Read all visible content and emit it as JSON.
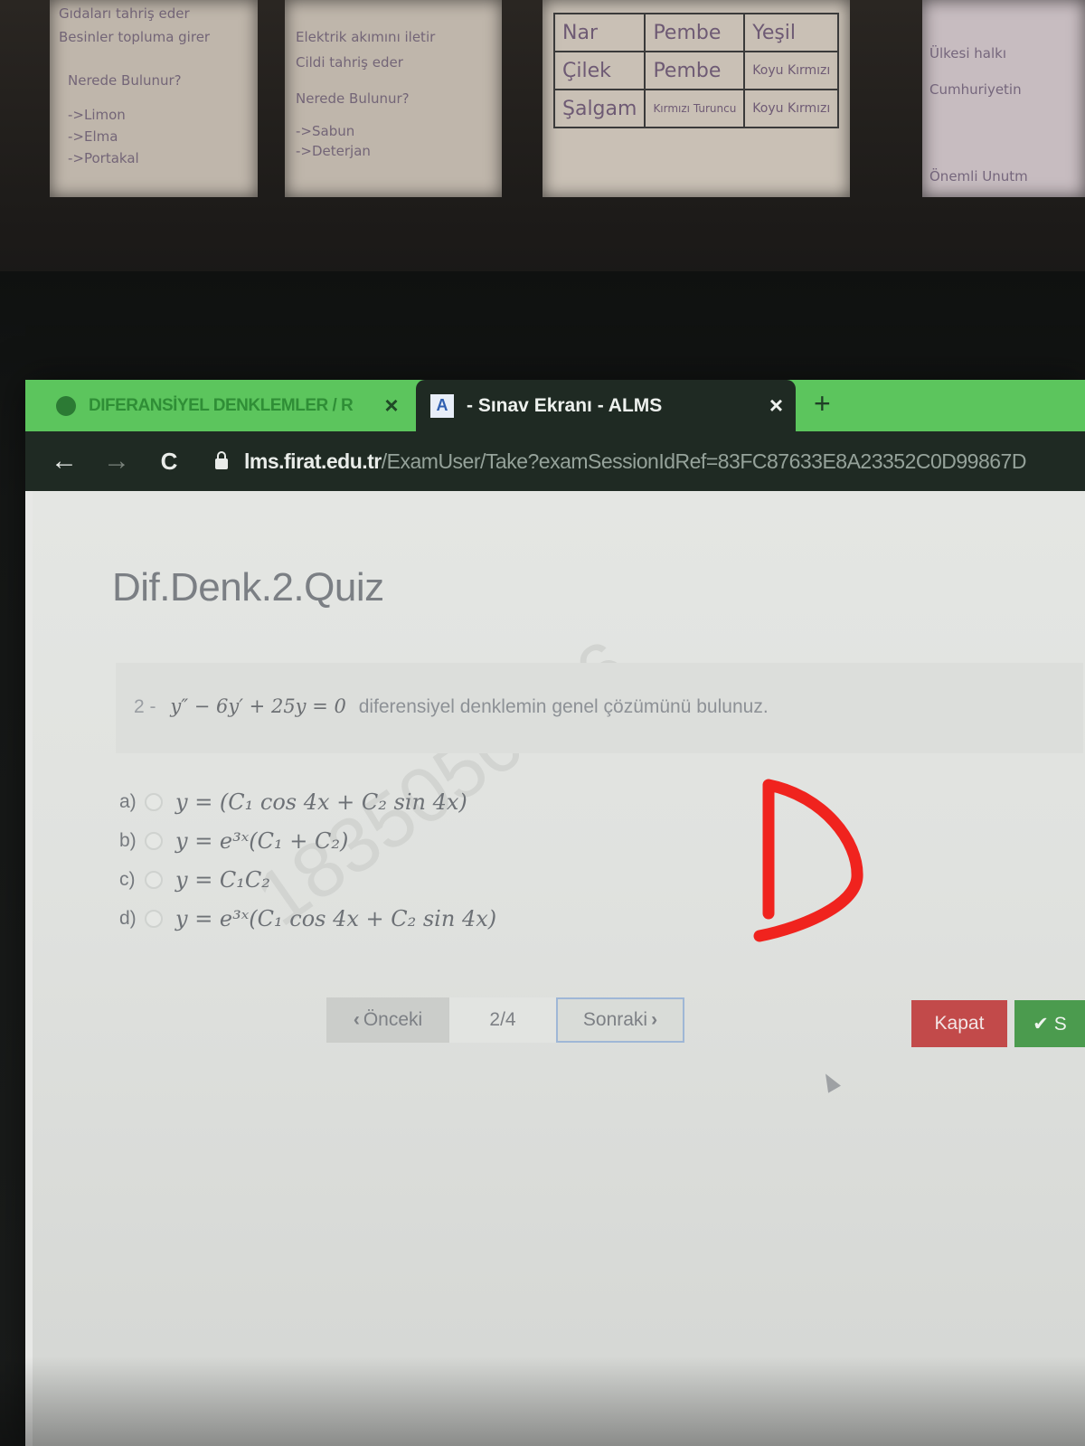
{
  "wall": {
    "poster1_lines": [
      "Gıdaları tahriş eder",
      "Besinler topluma girer",
      "Nerede Bulunur?",
      "->Limon",
      "->Elma",
      "->Portakal"
    ],
    "poster2_lines": [
      "Elektrik akımını iletir",
      "Cildi tahriş eder",
      "Nerede Bulunur?",
      "->Sabun",
      "->Deterjan"
    ],
    "poster3_table": [
      [
        "Nar",
        "Pembe",
        "Yeşil"
      ],
      [
        "Çilek",
        "Pembe",
        "Koyu Kırmızı"
      ],
      [
        "Şalgam",
        "Kırmızı Turuncu",
        "Koyu Kırmızı"
      ]
    ],
    "poster4_lines": [
      "Ülkesi halkı",
      "Cumhuriyetin",
      "Önemli Unutm"
    ]
  },
  "browser": {
    "tabs": [
      {
        "label": "DIFERANSİYEL DENKLEMLER / R",
        "close": "×"
      },
      {
        "label": "- Sınav Ekranı - ALMS",
        "icon_label": "A",
        "close": "×"
      }
    ],
    "new_tab": "+",
    "nav": {
      "back": "←",
      "forward": "→",
      "reload": "C"
    },
    "url": {
      "host": "lms.firat.edu.tr",
      "path": "/ExamUser/Take?examSessionIdRef=83FC87633E8A23352C0D99867D"
    }
  },
  "exam": {
    "title": "Dif.Denk.2.Quiz",
    "question": {
      "number": "2 -",
      "equation": "y″ − 6y′ + 25y = 0",
      "text": "diferensiyel denklemin genel çözümünü bulunuz."
    },
    "options": [
      {
        "letter": "a)",
        "formula": "y = (C₁ cos 4x + C₂ sin 4x)"
      },
      {
        "letter": "b)",
        "formula": "y = e³ˣ(C₁ + C₂)"
      },
      {
        "letter": "c)",
        "formula": "y = C₁C₂"
      },
      {
        "letter": "d)",
        "formula": "y = e³ˣ(C₁ cos 4x + C₂ sin 4x)"
      }
    ],
    "watermark": "1835050016",
    "pager": {
      "prev": "Önceki",
      "indicator": "2/4",
      "next": "Sonraki"
    },
    "close_button": "Kapat",
    "finish_button": "✔ S"
  },
  "annotation": {
    "handwritten_letter": "D",
    "color": "#f0231e"
  },
  "colors": {
    "tab_green": "#5cc55d",
    "close_red": "#c24a4a",
    "finish_green": "#4b9b4e"
  }
}
